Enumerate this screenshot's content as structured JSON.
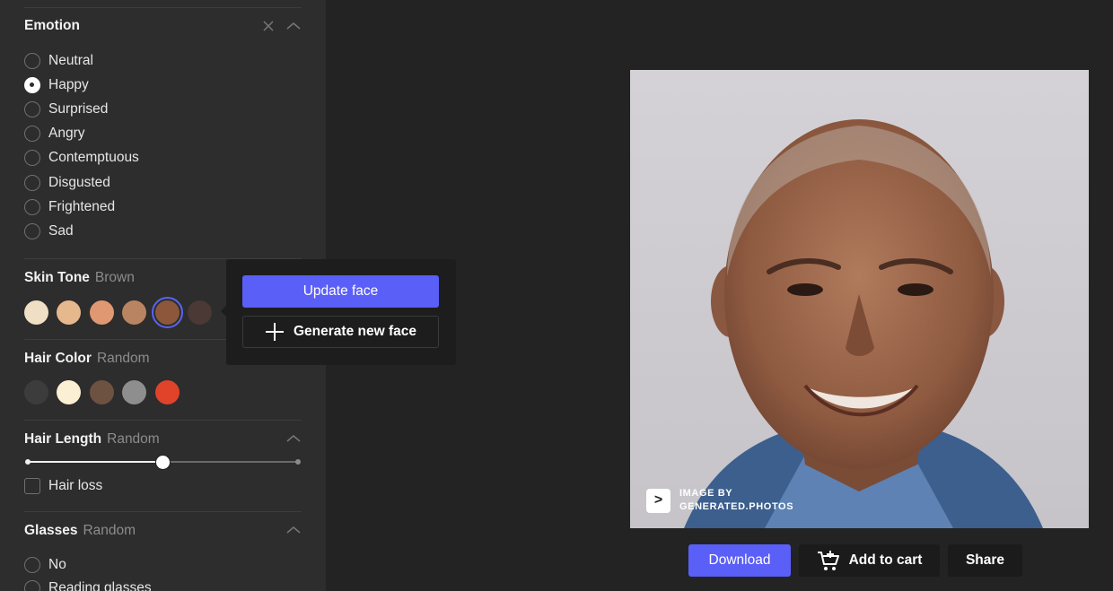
{
  "emotion": {
    "title": "Emotion",
    "options": [
      "Neutral",
      "Happy",
      "Surprised",
      "Angry",
      "Contemptuous",
      "Disgusted",
      "Frightened",
      "Sad"
    ],
    "selected": "Happy"
  },
  "skin_tone": {
    "title": "Skin Tone",
    "value": "Brown",
    "swatches": [
      "#efe0c5",
      "#e6b88d",
      "#e09872",
      "#b98462",
      "#8c573a",
      "#4a3935"
    ],
    "selected_index": 4
  },
  "hair_color": {
    "title": "Hair Color",
    "value": "Random",
    "swatches": [
      "#3c3c3c",
      "#fbefd4",
      "#6e5241",
      "#8e8e8e",
      "#e0432a"
    ]
  },
  "hair_length": {
    "title": "Hair Length",
    "value": "Random",
    "slider_level": 0.5,
    "hair_loss_label": "Hair loss",
    "hair_loss_checked": false
  },
  "glasses": {
    "title": "Glasses",
    "value": "Random",
    "options": [
      "No",
      "Reading glasses"
    ]
  },
  "popover": {
    "update_label": "Update face",
    "generate_label": "Generate new face"
  },
  "watermark": {
    "line1": "IMAGE BY",
    "line2": "GENERATED.PHOTOS"
  },
  "actions": {
    "download_label": "Download",
    "cart_label": "Add to cart",
    "share_label": "Share"
  },
  "colors": {
    "accent": "#5a5ff7",
    "panel": "#2d2d2d",
    "background": "#232323"
  }
}
